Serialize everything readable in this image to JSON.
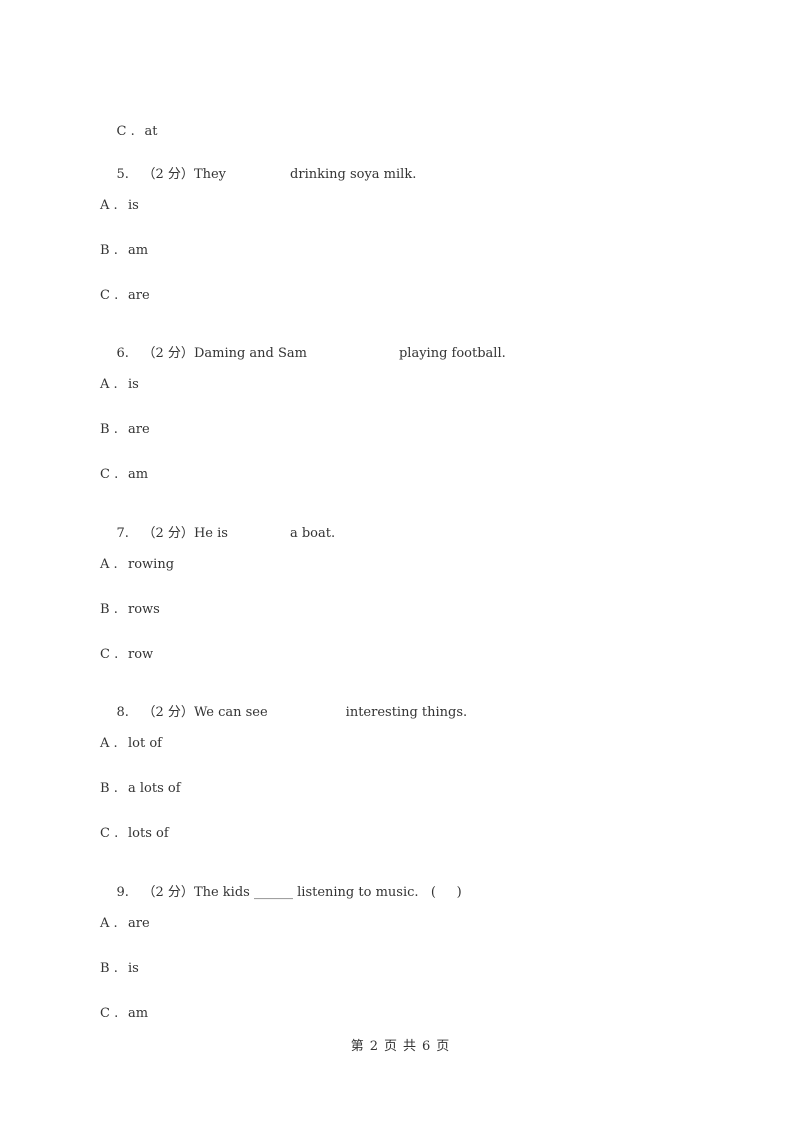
{
  "page": {
    "leading_option": {
      "letter": "C",
      "sep": ".",
      "text": "at"
    },
    "questions": [
      {
        "num": "5.",
        "points": "（2 分）",
        "before": "They",
        "blank": "",
        "after": "drinking soya milk.",
        "options": [
          {
            "letter": "A",
            "text": "is"
          },
          {
            "letter": "B",
            "text": "am"
          },
          {
            "letter": "C",
            "text": "are"
          }
        ]
      },
      {
        "num": "6.",
        "points": "（2 分）",
        "before": "Daming and Sam",
        "blank": "",
        "after": "playing football.",
        "options": [
          {
            "letter": "A",
            "text": "is"
          },
          {
            "letter": "B",
            "text": "are"
          },
          {
            "letter": "C",
            "text": "am"
          }
        ]
      },
      {
        "num": "7.",
        "points": "（2 分）",
        "before": "He is",
        "blank": "",
        "after": "a boat.",
        "options": [
          {
            "letter": "A",
            "text": "rowing"
          },
          {
            "letter": "B",
            "text": "rows"
          },
          {
            "letter": "C",
            "text": "row"
          }
        ]
      },
      {
        "num": "8.",
        "points": "（2 分）",
        "before": "We can see",
        "blank": "",
        "after": "interesting things.",
        "options": [
          {
            "letter": "A",
            "text": "lot of"
          },
          {
            "letter": "B",
            "text": "a lots of"
          },
          {
            "letter": "C",
            "text": "lots of"
          }
        ]
      },
      {
        "num": "9.",
        "points": "（2 分）",
        "before": "The kids",
        "blank": "______",
        "after": "listening to music.   (     )",
        "options": [
          {
            "letter": "A",
            "text": "are"
          },
          {
            "letter": "B",
            "text": "is"
          },
          {
            "letter": "C",
            "text": "am"
          }
        ]
      }
    ],
    "option_sep": ".",
    "footer": {
      "prefix": "第",
      "current": "2",
      "mid1": "页",
      "mid2": "共",
      "total": "6",
      "suffix": "页"
    }
  }
}
